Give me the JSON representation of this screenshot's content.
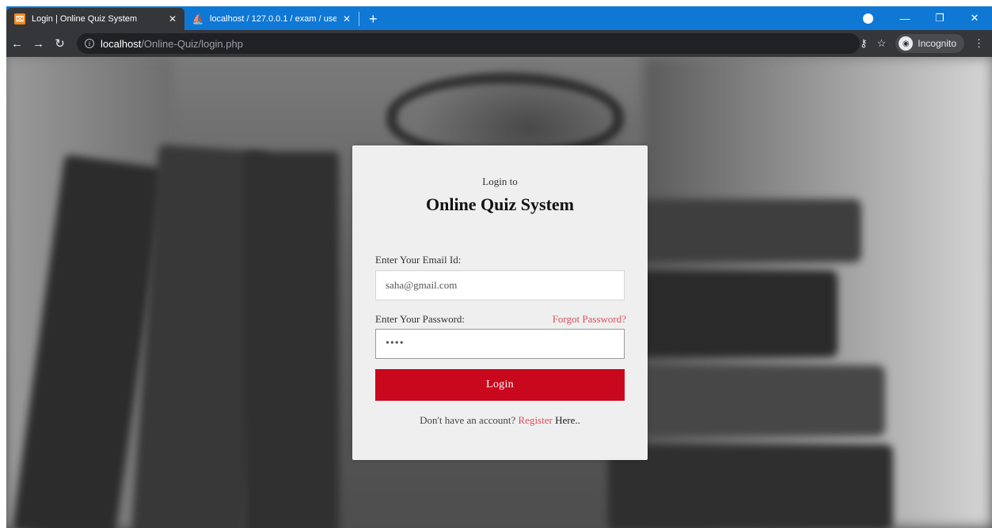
{
  "browser": {
    "tabs": [
      {
        "title": "Login | Online Quiz System",
        "active": true,
        "icon": "quiz-favicon"
      },
      {
        "title": "localhost / 127.0.0.1 / exam / use",
        "active": false,
        "icon": "phpmyadmin-favicon"
      }
    ],
    "address": {
      "host": "localhost",
      "path": "/Online-Quiz/login.php"
    },
    "profile_label": "Incognito"
  },
  "login_card": {
    "subtitle": "Login to",
    "title": "Online Quiz System",
    "email_label": "Enter Your Email Id:",
    "email_value": "saha@gmail.com",
    "password_label": "Enter Your Password:",
    "forgot_link": "Forgot Password?",
    "password_value": "••••",
    "login_button": "Login",
    "register_prompt": "Don't have an account?",
    "register_link": "Register",
    "register_suffix": "Here.."
  },
  "colors": {
    "tabstrip": "#0f78d4",
    "toolbar": "#35363a",
    "login_button": "#c9081d",
    "link": "#d94f5c"
  }
}
